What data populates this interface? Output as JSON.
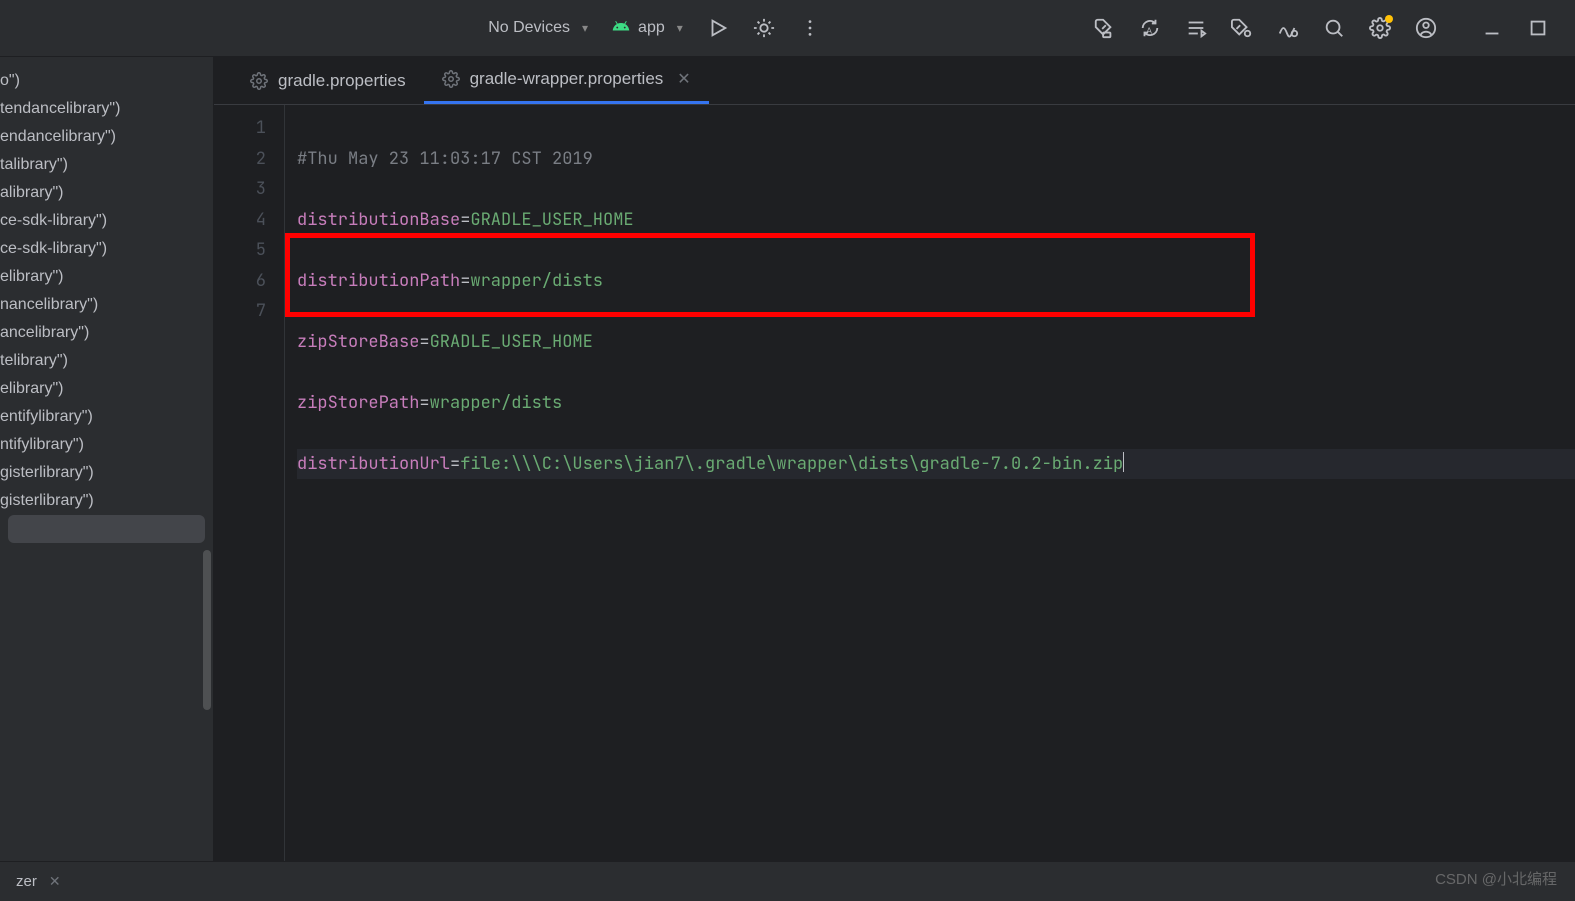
{
  "toolbar": {
    "device_label": "No Devices",
    "app_label": "app"
  },
  "sidebar": {
    "items": [
      "o\")",
      "tendancelibrary\")",
      "endancelibrary\")",
      "talibrary\")",
      "alibrary\")",
      "ce-sdk-library\")",
      "ce-sdk-library\")",
      "elibrary\")",
      "nancelibrary\")",
      "ancelibrary\")",
      "telibrary\")",
      "elibrary\")",
      "entifylibrary\")",
      "ntifylibrary\")",
      "gisterlibrary\")",
      "gisterlibrary\")"
    ]
  },
  "tabs": [
    {
      "label": "gradle.properties",
      "active": false,
      "closeable": false
    },
    {
      "label": "gradle-wrapper.properties",
      "active": true,
      "closeable": true
    }
  ],
  "gutter_lines": [
    "1",
    "2",
    "3",
    "4",
    "5",
    "6",
    "7"
  ],
  "code": {
    "l1_comment": "#Thu May 23 11:03:17 CST 2019",
    "l2_key": "distributionBase",
    "l2_val": "GRADLE_USER_HOME",
    "l3_key": "distributionPath",
    "l3_val": "wrapper/dists",
    "l4_key": "zipStoreBase",
    "l4_val": "GRADLE_USER_HOME",
    "l5_key": "zipStorePath",
    "l5_val": "wrapper/dists",
    "l6_key": "distributionUrl",
    "l6_val": "file:\\\\\\C:\\Users\\jian7\\.gradle\\wrapper\\dists\\gradle-7.0.2-bin.zip"
  },
  "status": {
    "left_text": "zer"
  },
  "watermark": "CSDN @小北编程"
}
